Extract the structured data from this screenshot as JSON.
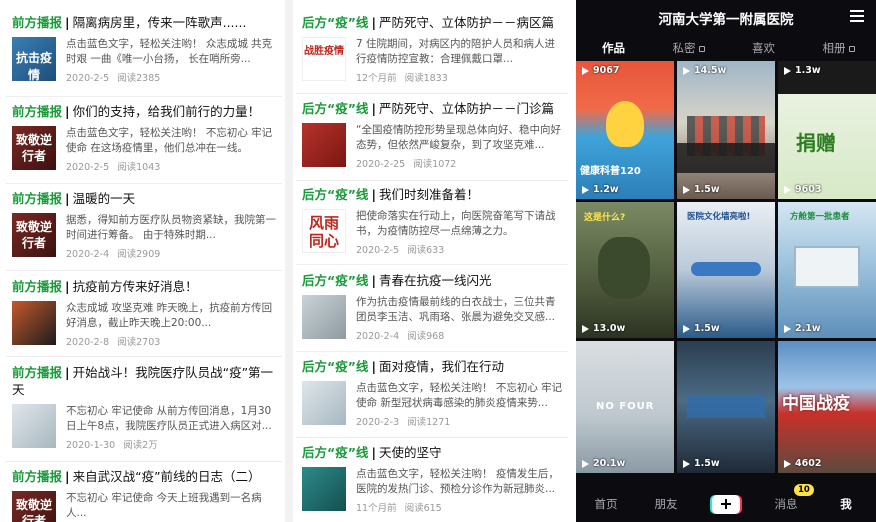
{
  "left_list": [
    {
      "tag": "前方播报",
      "title": "隔离病房里，传来一阵歌声......",
      "desc": "点击蓝色文字，轻松关注哟！ 众志成城 共克时艰 一曲《唯一小台扬，  长在哨所旁...",
      "date": "2020-2-5",
      "reads": "阅读2385",
      "thumb_text": "抗击疫情"
    },
    {
      "tag": "前方播报",
      "title": "你们的支持，给我们前行的力量！",
      "desc": "点击蓝色文字，轻松关注哟！ 不忘初心 牢记使命 在这场疫情里，他们总冲在一线。",
      "date": "2020-2-5",
      "reads": "阅读1043",
      "thumb_text": "致敬逆行者"
    },
    {
      "tag": "前方播报",
      "title": "温暖的一天",
      "desc": "据悉，得知前方医疗队员物资紧缺，我院第一时间进行筹备。 由于特殊时期...",
      "desc_hl": "前方",
      "date": "2020-2-4",
      "reads": "阅读2909",
      "thumb_text": "致敬逆行者"
    },
    {
      "tag": "前方播报",
      "title": "抗疫前方传来好消息！",
      "desc": "众志成城 攻坚克难 昨天晚上，抗疫前方传回好消息，截止昨天晚上20:00...",
      "date": "2020-2-8",
      "reads": "阅读2703",
      "thumb_text": ""
    },
    {
      "tag": "前方播报",
      "title": "开始战斗！我院医疗队员战“疫”第一天",
      "desc": "不忘初心 牢记使命 从前方传回消息，1月30日上午8点，我院医疗队员正式进入病区对...",
      "date": "2020-1-30",
      "reads": "阅读2万",
      "thumb_text": ""
    },
    {
      "tag": "前方播报",
      "title": "来自武汉战“疫”前线的日志（二）",
      "desc": "不忘初心 牢记使命 今天上班我遇到一名病人...",
      "date": "",
      "reads": "",
      "thumb_text": "致敬逆行者"
    }
  ],
  "mid_list": [
    {
      "tag": "后方“疫”线",
      "title": "严防死守、立体防护－－病区篇",
      "desc": "7 住院期间，对病区内的陪护人员和病人进行疫情防控宣教：合理佩戴口罩...",
      "date": "12个月前",
      "reads": "阅读1833",
      "thumb_text": "战胜疫情"
    },
    {
      "tag": "后方“疫”线",
      "title": "严防死守、立体防护－－门诊篇",
      "desc": "“全国疫情防控形势呈现总体向好、稳中向好态势，但依然严峻复杂，到了攻坚克难...",
      "date": "2020-2-25",
      "reads": "阅读1072",
      "thumb_text": ""
    },
    {
      "tag": "后方“疫”线",
      "title": "我们时刻准备着！",
      "desc": "把使命落实在行动上，向医院奋笔写下请战书，为疫情防控尽一点绵薄之力。",
      "date": "2020-2-5",
      "reads": "阅读633",
      "thumb_text": "风雨同心"
    },
    {
      "tag": "后方“疫”线",
      "title": "青春在抗疫一线闪光",
      "desc": "作为抗击疫情最前线的白衣战士，三位共青团员李玉洁、巩雨珞、张晨为避免交叉感...",
      "date": "2020-2-4",
      "reads": "阅读968",
      "thumb_text": ""
    },
    {
      "tag": "后方“疫”线",
      "title": "面对疫情，我们在行动",
      "desc": "点击蓝色文字，轻松关注哟！ 不忘初心 牢记使命 新型冠状病毒感染的肺炎疫情来势...",
      "date": "2020-2-3",
      "reads": "阅读1271",
      "thumb_text": ""
    },
    {
      "tag": "后方“疫”线",
      "title": "天使的坚守",
      "desc": "点击蓝色文字，轻松关注哟！ 疫情发生后，医院的发热门诊、预检分诊作为新冠肺炎...",
      "date": "11个月前",
      "reads": "阅读615",
      "thumb_text": ""
    }
  ],
  "phone": {
    "account_name": "河南大学第一附属医院",
    "tabs": [
      {
        "label": "作品",
        "active": true,
        "locked": false
      },
      {
        "label": "私密",
        "active": false,
        "locked": true
      },
      {
        "label": "喜欢",
        "active": false,
        "locked": false
      },
      {
        "label": "相册",
        "active": false,
        "locked": true
      }
    ],
    "videos": [
      {
        "count": "9067",
        "bottom": "1.2w",
        "caption": "健康科普120"
      },
      {
        "count": "14.5w",
        "bottom": "1.5w",
        "caption": ""
      },
      {
        "count": "1.3w",
        "bottom": "9603",
        "caption": "捐赠"
      },
      {
        "count": "",
        "bottom": "13.0w",
        "caption": "这是什么?"
      },
      {
        "count": "",
        "bottom": "1.5w",
        "caption": "医院文化墙亮啦!"
      },
      {
        "count": "",
        "bottom": "2.1w",
        "caption": "方舱第一批患者"
      },
      {
        "count": "",
        "bottom": "20.1w",
        "caption": "NO FOUR"
      },
      {
        "count": "",
        "bottom": "1.5w",
        "caption": ""
      },
      {
        "count": "",
        "bottom": "4602",
        "caption": "中国战疫"
      }
    ],
    "nav": {
      "home": "首页",
      "friends": "朋友",
      "messages": "消息",
      "messages_badge": "10",
      "me": "我"
    }
  }
}
